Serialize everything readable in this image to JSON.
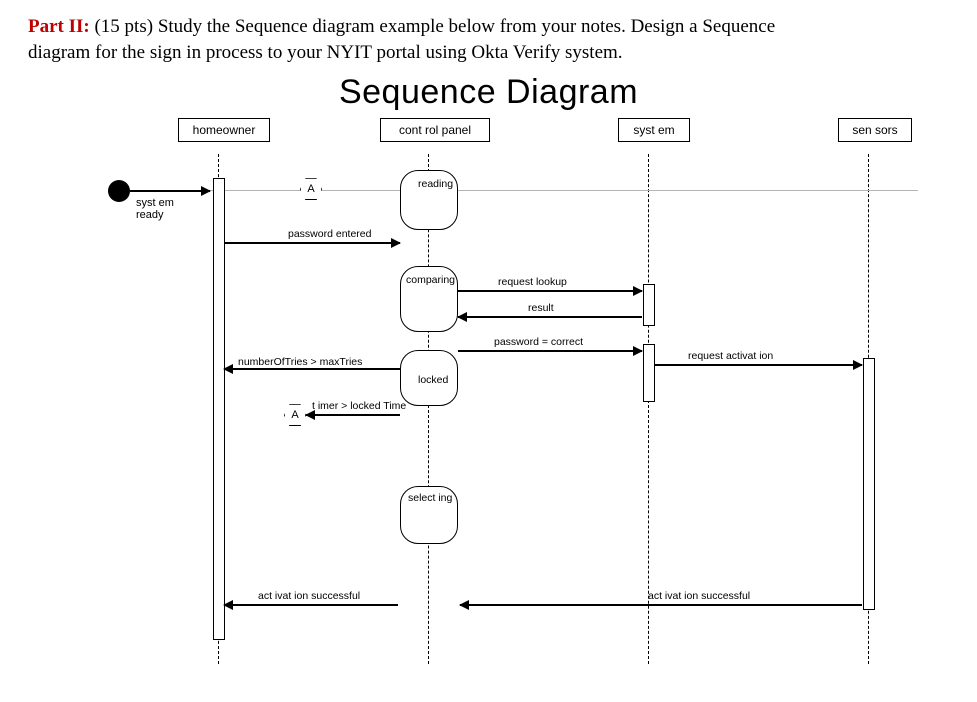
{
  "question": {
    "part_label": "Part II:",
    "points": "(15 pts)",
    "text_a": "Study the Sequence diagram example below from your notes. Design a Sequence",
    "text_b": "diagram for the sign in process to your NYIT portal using Okta Verify system."
  },
  "title": "Sequence Diagram",
  "participants": {
    "homeowner": "homeowner",
    "controlpanel": "cont rol panel",
    "system": "syst em",
    "sensors": "sen sors"
  },
  "start_label": "syst em\nready",
  "connector_label": "A",
  "states": {
    "reading": "reading",
    "comparing": "comparing",
    "locked": "locked",
    "selecting": "select ing"
  },
  "messages": {
    "password_entered": "password  entered",
    "request_lookup": "request  lookup",
    "result": "result",
    "password_correct": "password = correct",
    "num_tries": "numberOfTries > maxTries",
    "timer_locked": "t imer > locked Time",
    "request_activation": "request activat ion",
    "activation_successful_1": "act ivat ion successful",
    "activation_successful_2": "act ivat ion successful"
  },
  "chart_data": {
    "type": "sequence-diagram",
    "participants": [
      "homeowner",
      "control panel",
      "system",
      "sensors"
    ],
    "initial_state": "system ready",
    "interactions": [
      {
        "from": "homeowner",
        "to": "control panel",
        "message": "password entered",
        "resulting_state": "reading"
      },
      {
        "state_on": "control panel",
        "state": "comparing"
      },
      {
        "from": "control panel",
        "to": "system",
        "message": "request lookup"
      },
      {
        "from": "system",
        "to": "control panel",
        "message": "result",
        "return": true
      },
      {
        "from": "control panel",
        "to": "system",
        "message": "password = correct"
      },
      {
        "from": "control panel",
        "to": "homeowner",
        "message": "numberOfTries > maxTries",
        "resulting_state": "locked",
        "guard": true
      },
      {
        "self": "control panel",
        "message": "timer > lockedTime",
        "connector": "A",
        "guard": true
      },
      {
        "from": "system",
        "to": "sensors",
        "message": "request activation"
      },
      {
        "state_on": "control panel",
        "state": "selecting"
      },
      {
        "from": "sensors",
        "to": "system",
        "message": "activation successful",
        "return": true
      },
      {
        "from": "control panel",
        "to": "homeowner",
        "message": "activation successful",
        "return": true
      }
    ]
  }
}
